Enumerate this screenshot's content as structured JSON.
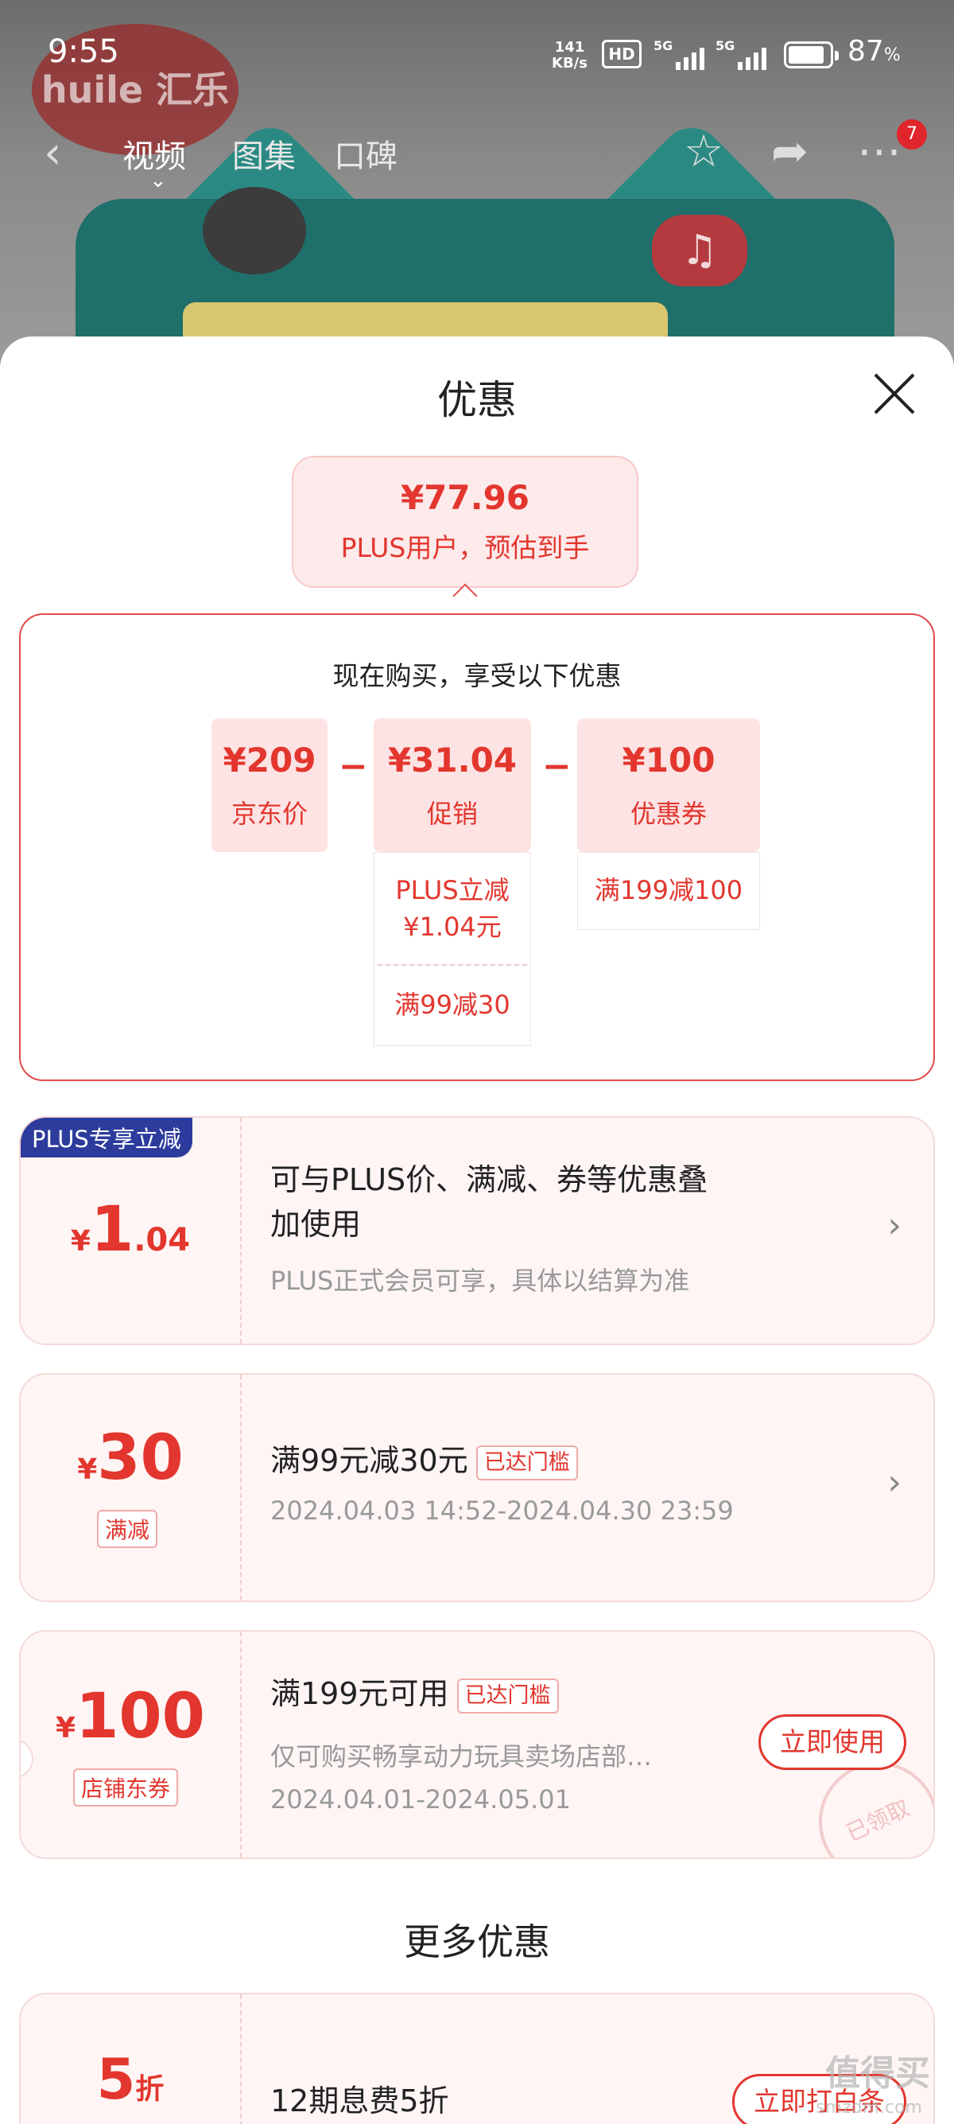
{
  "status_bar": {
    "time": "9:55",
    "net_rate_value": "141",
    "net_rate_unit": "KB/s",
    "hd_label": "HD",
    "signal_1": "5G",
    "signal_2": "5G",
    "battery_percent": "87",
    "battery_unit": "%"
  },
  "product_nav": {
    "tabs": [
      "视频",
      "图集",
      "口碑"
    ],
    "notification_count": "7"
  },
  "brand_logo_text": "huile 汇乐",
  "sheet": {
    "title": "优惠",
    "estimate": {
      "price": "¥77.96",
      "label": "PLUS用户，预估到手"
    },
    "breakdown": {
      "heading": "现在购买，享受以下优惠",
      "items": [
        {
          "value": "¥209",
          "label": "京东价"
        },
        {
          "value": "¥31.04",
          "label": "促销"
        },
        {
          "value": "¥100",
          "label": "优惠券"
        }
      ],
      "promo_details": [
        "PLUS立减",
        "¥1.04元",
        "满99减30"
      ],
      "coupon_details": [
        "满199减100"
      ]
    },
    "coupons": [
      {
        "badge": "PLUS专享立减",
        "symbol": "¥",
        "amount_int": "1",
        "amount_dec": ".04",
        "title_line1": "可与PLUS价、满减、券等优惠叠",
        "title_line2": "加使用",
        "desc": "PLUS正式会员可享，具体以结算为准"
      },
      {
        "symbol": "¥",
        "amount_int": "30",
        "tag": "满减",
        "title": "满99元减30元",
        "status": "已达门槛",
        "desc": "2024.04.03 14:52-2024.04.30 23:59"
      },
      {
        "symbol": "¥",
        "amount_int": "100",
        "tag": "店铺东券",
        "title": "满199元可用",
        "status": "已达门槛",
        "desc": "仅可购买畅享动力玩具卖场店部…",
        "date": "2024.04.01-2024.05.01",
        "action": "立即使用",
        "stamp": "已领取"
      }
    ],
    "more_title": "更多优惠",
    "more_coupon": {
      "amount_int": "5",
      "amount_unit": "折",
      "title": "12期息费5折",
      "action": "立即打白条"
    }
  },
  "watermark": "值得买",
  "watermark_url": "smzdm.com",
  "colors": {
    "accent": "#e2362e",
    "plus_badge": "#2c3b9c",
    "card_bg": "#fff5f5"
  }
}
